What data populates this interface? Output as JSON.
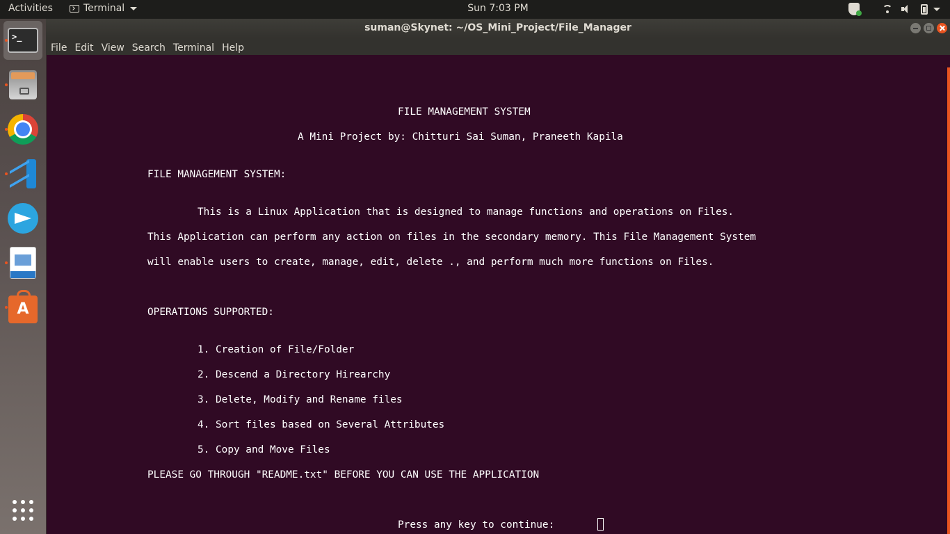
{
  "topbar": {
    "activities": "Activities",
    "app_name": "Terminal",
    "clock": "Sun  7:03 PM"
  },
  "window": {
    "title": "suman@Skynet: ~/OS_Mini_Project/File_Manager"
  },
  "menu": [
    "File",
    "Edit",
    "View",
    "Search",
    "Terminal",
    "Help"
  ],
  "terminal": {
    "heading": "FILE MANAGEMENT SYSTEM",
    "byline": "A Mini Project by: Chitturi Sai Suman, Praneeth Kapila",
    "section1": "FILE MANAGEMENT SYSTEM:",
    "desc1": "This is a Linux Application that is designed to manage functions and operations on Files.",
    "desc2": "This Application can perform any action on files in the secondary memory. This File Management System",
    "desc3": "will enable users to create, manage, edit, delete ., and perform much more functions on Files.",
    "section2": "OPERATIONS SUPPORTED:",
    "ops": [
      "1. Creation of File/Folder",
      "2. Descend a Directory Hirearchy",
      "3. Delete, Modify and Rename files",
      "4. Sort files based on Several Attributes",
      "5. Copy and Move Files"
    ],
    "notice": "PLEASE GO THROUGH \"README.txt\" BEFORE YOU CAN USE THE APPLICATION",
    "prompt": "Press any key to continue:"
  },
  "dock": {
    "items": [
      "terminal-icon",
      "files-icon",
      "chrome-icon",
      "vscode-icon",
      "telegram-icon",
      "writer-icon",
      "software-store-icon",
      "show-apps-icon"
    ]
  },
  "colors": {
    "terminal_bg": "#300a24",
    "accent": "#e95420",
    "topbar_bg": "#1d1d1b"
  }
}
